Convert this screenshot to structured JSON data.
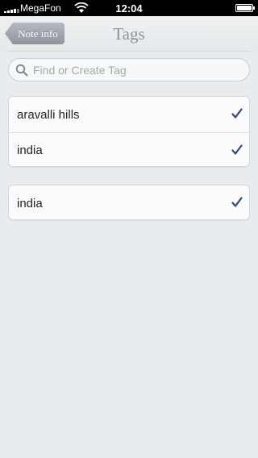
{
  "status_bar": {
    "carrier": "MegaFon",
    "time": "12:04"
  },
  "nav": {
    "back_label": "Note info",
    "title": "Tags"
  },
  "search": {
    "placeholder": "Find or Create Tag"
  },
  "groups": [
    {
      "rows": [
        {
          "label": "aravalli hills",
          "checked": true,
          "icon": "checkmark-icon"
        },
        {
          "label": "india",
          "checked": true,
          "icon": "checkmark-icon"
        }
      ]
    },
    {
      "rows": [
        {
          "label": "india",
          "checked": true,
          "icon": "checkmark-icon"
        }
      ]
    }
  ],
  "colors": {
    "check": "#2d4b7a",
    "background": "#e9ecee"
  }
}
